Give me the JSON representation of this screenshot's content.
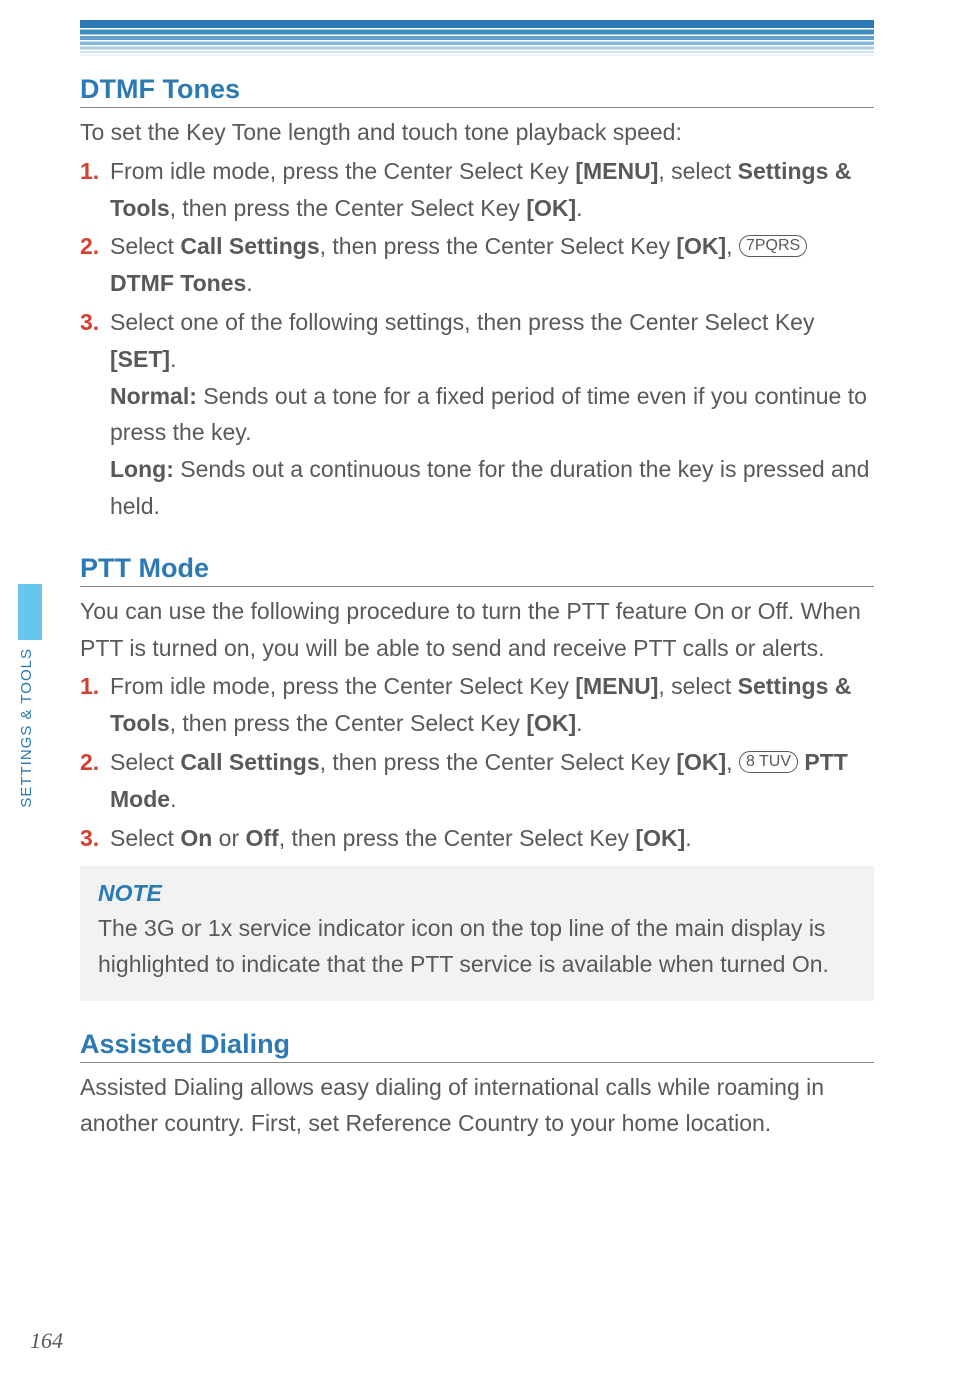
{
  "side_tab_label": "SETTINGS & TOOLS",
  "page_number": "164",
  "sections": {
    "dtmf": {
      "heading": "DTMF Tones",
      "intro": "To set the Key Tone length and touch tone playback speed:",
      "step1": {
        "num": "1.",
        "t1": "From idle mode, press the Center Select Key ",
        "b1": "[MENU]",
        "t2": ", select ",
        "b2": "Settings & Tools",
        "t3": ", then press the Center Select Key ",
        "b3": "[OK]",
        "t4": "."
      },
      "step2": {
        "num": "2.",
        "t1": "Select ",
        "b1": "Call Settings",
        "t2": ", then press the Center Select Key ",
        "b2": "[OK]",
        "t3": ", ",
        "key": "7PQRS",
        "t4": " ",
        "b3": "DTMF Tones",
        "t5": "."
      },
      "step3": {
        "num": "3.",
        "t1": "Select one of the following settings, then press the Center Select Key ",
        "b1": "[SET]",
        "t2": "."
      },
      "normal": {
        "label": "Normal:",
        "text": " Sends out a tone for a fixed period of time even if you continue to press the key."
      },
      "long": {
        "label": "Long:",
        "text": " Sends out a continuous tone for the duration the key is pressed and held."
      }
    },
    "ptt": {
      "heading": "PTT Mode",
      "intro": "You can use the following procedure to turn the PTT feature On or Off. When PTT is turned on, you will be able to send and receive PTT calls or alerts.",
      "step1": {
        "num": "1.",
        "t1": "From idle mode, press the Center Select Key ",
        "b1": "[MENU]",
        "t2": ", select ",
        "b2": "Settings & Tools",
        "t3": ", then press the Center Select Key ",
        "b3": "[OK]",
        "t4": "."
      },
      "step2": {
        "num": "2.",
        "t1": "Select ",
        "b1": "Call Settings",
        "t2": ", then press the Center Select Key ",
        "b2": "[OK]",
        "t3": ", ",
        "key": "8 TUV",
        "t4": " ",
        "b3": "PTT Mode",
        "t5": "."
      },
      "step3": {
        "num": "3.",
        "t1": "Select ",
        "b1": "On",
        "t2": " or ",
        "b2": "Off",
        "t3": ", then press the Center Select Key ",
        "b3": "[OK]",
        "t4": "."
      },
      "note": {
        "heading": "NOTE",
        "text": "The 3G or 1x service indicator icon on the top line of the main display is highlighted to indicate that the PTT service is available when turned On."
      }
    },
    "assisted": {
      "heading": "Assisted Dialing",
      "intro": "Assisted Dialing allows easy dialing of international calls while roaming in another country. First, set Reference Country to your home location."
    }
  }
}
